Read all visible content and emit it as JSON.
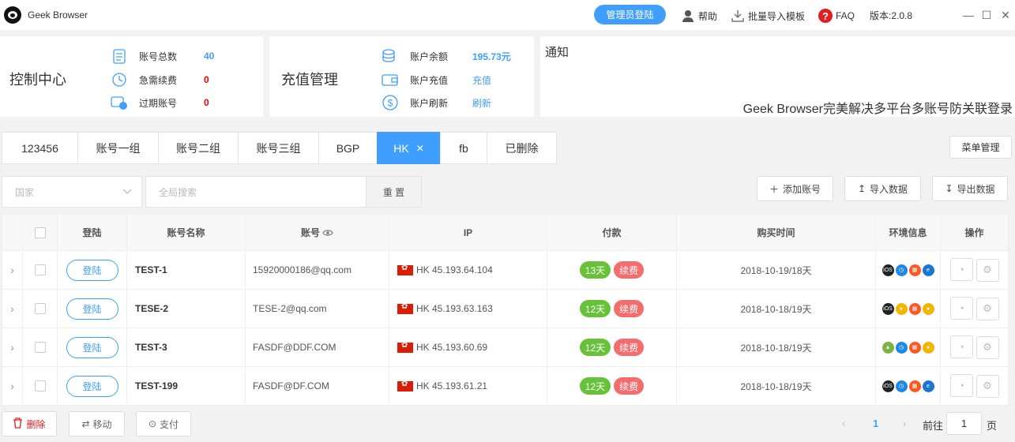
{
  "app": {
    "title": "Geek Browser",
    "admin_login": "管理员登陆",
    "help": "帮助",
    "import_template": "批量导入模板",
    "faq": "FAQ",
    "version": "版本:2.0.8"
  },
  "control": {
    "title": "控制中心",
    "total_label": "账号总数",
    "total_value": "40",
    "urgent_label": "急需续费",
    "urgent_value": "0",
    "expired_label": "过期账号",
    "expired_value": "0"
  },
  "recharge": {
    "title": "充值管理",
    "balance_label": "账户余额",
    "balance_value": "195.73元",
    "recharge_label": "账户充值",
    "recharge_action": "充值",
    "refresh_label": "账户刷新",
    "refresh_action": "刷新"
  },
  "notice": {
    "title": "通知",
    "text": "Geek Browser完美解决多平台多账号防关联登录"
  },
  "tabs": [
    {
      "label": "123456"
    },
    {
      "label": "账号一组"
    },
    {
      "label": "账号二组"
    },
    {
      "label": "账号三组"
    },
    {
      "label": "BGP"
    },
    {
      "label": "HK",
      "active": true
    },
    {
      "label": "fb"
    },
    {
      "label": "已删除"
    }
  ],
  "menu_manage": "菜单管理",
  "filters": {
    "country_placeholder": "国家",
    "search_placeholder": "全局搜索",
    "reset": "重 置"
  },
  "actions": {
    "add": "添加账号",
    "import": "导入数据",
    "export": "导出数据"
  },
  "table": {
    "headers": [
      "登陆",
      "账号名称",
      "账号",
      "IP",
      "付款",
      "购买时间",
      "环境信息",
      "操作"
    ],
    "login_label": "登陆",
    "renew_label": "续费",
    "rows": [
      {
        "name": "TEST-1",
        "account": "15920000186@qq.com",
        "ip": "HK 45.193.64.104",
        "days": "13天",
        "purchase": "2018-10-19/18天",
        "env": [
          "ios",
          "safari",
          "windows",
          "ie"
        ]
      },
      {
        "name": "TESE-2",
        "account": "TESE-2@qq.com",
        "ip": "HK 45.193.63.163",
        "days": "12天",
        "purchase": "2018-10-18/19天",
        "env": [
          "ios",
          "chrome",
          "windows",
          "chrome"
        ]
      },
      {
        "name": "TEST-3",
        "account": "FASDF@DDF.COM",
        "ip": "HK 45.193.60.69",
        "days": "12天",
        "purchase": "2018-10-18/19天",
        "env": [
          "android",
          "safari",
          "windows",
          "chrome"
        ]
      },
      {
        "name": "TEST-199",
        "account": "FASDF@DF.COM",
        "ip": "HK 45.193.61.21",
        "days": "12天",
        "purchase": "2018-10-18/19天",
        "env": [
          "ios",
          "safari",
          "windows",
          "ie"
        ]
      }
    ]
  },
  "bottom": {
    "delete": "删除",
    "move": "移动",
    "pay": "支付"
  },
  "pagination": {
    "current": "1",
    "goto": "前往",
    "page_input": "1",
    "page_suffix": "页"
  },
  "colors": {
    "accent": "#409eff",
    "green": "#67c23a",
    "red": "#f56c6c"
  }
}
